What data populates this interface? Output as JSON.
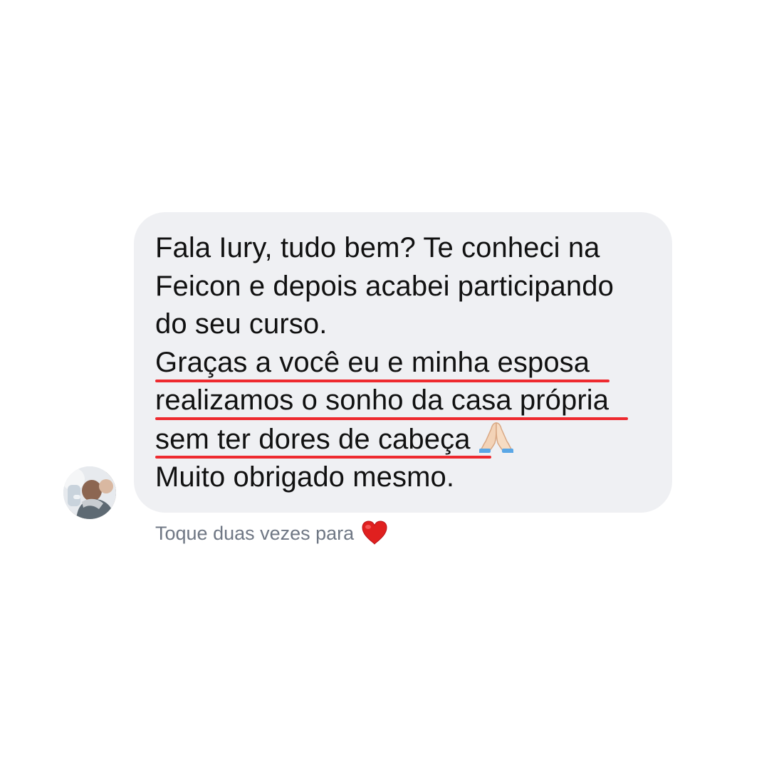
{
  "message": {
    "lines": [
      "Fala Iury, tudo bem? Te conheci na",
      "Feicon e depois acabei participando",
      "do seu curso.",
      "Graças a você eu e minha esposa",
      "realizamos o sonho da casa própria",
      "sem ter dores de cabeça",
      "Muito obrigado mesmo."
    ],
    "emoji": "folded-hands-icon",
    "highlight_color": "#ee2a2f"
  },
  "hint": {
    "text": "Toque duas vezes para",
    "icon": "heart-icon"
  },
  "colors": {
    "bubble": "#eff0f3",
    "text": "#111111",
    "hint": "#6f7784"
  }
}
